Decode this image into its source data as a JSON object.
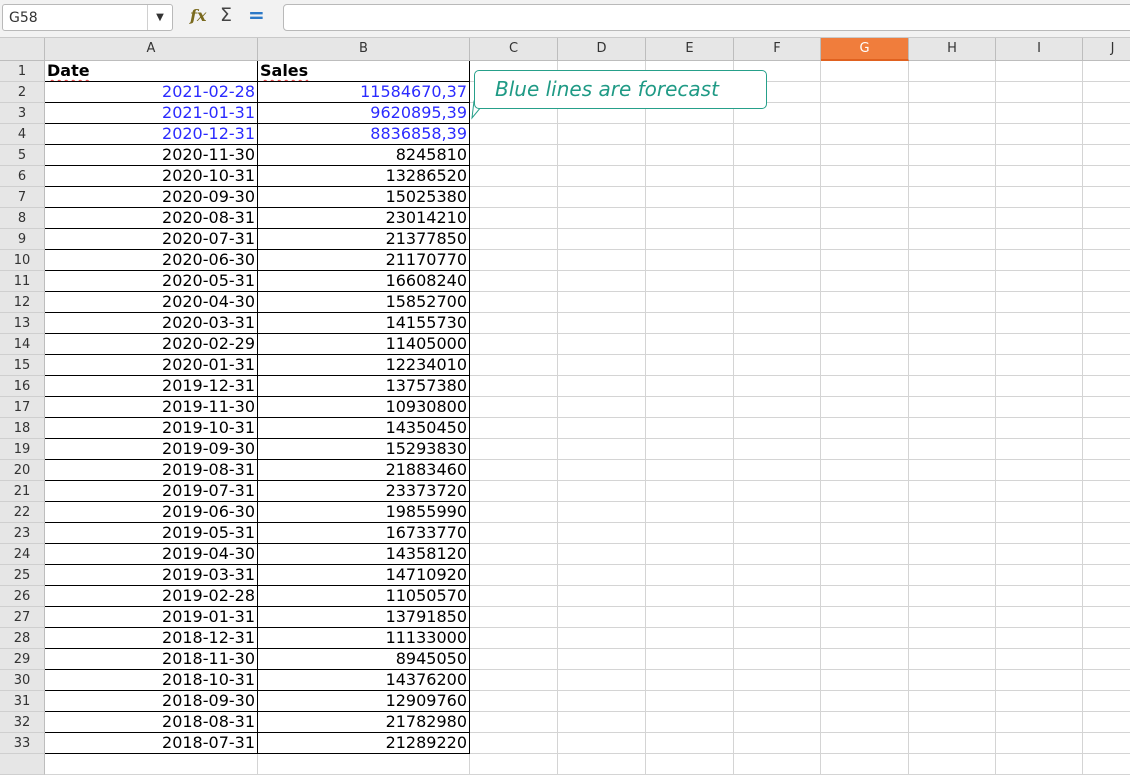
{
  "toolbar": {
    "name_box": "G58",
    "formula": ""
  },
  "columns": [
    "A",
    "B",
    "C",
    "D",
    "E",
    "F",
    "G",
    "H",
    "I",
    "J"
  ],
  "active_column": "G",
  "header_row": {
    "row": "1",
    "date": "Date",
    "sales": "Sales"
  },
  "rows": [
    {
      "row": "2",
      "date": "2021-02-28",
      "sales": "11584670,37",
      "forecast": true
    },
    {
      "row": "3",
      "date": "2021-01-31",
      "sales": "9620895,39",
      "forecast": true
    },
    {
      "row": "4",
      "date": "2020-12-31",
      "sales": "8836858,39",
      "forecast": true
    },
    {
      "row": "5",
      "date": "2020-11-30",
      "sales": "8245810",
      "forecast": false
    },
    {
      "row": "6",
      "date": "2020-10-31",
      "sales": "13286520",
      "forecast": false
    },
    {
      "row": "7",
      "date": "2020-09-30",
      "sales": "15025380",
      "forecast": false
    },
    {
      "row": "8",
      "date": "2020-08-31",
      "sales": "23014210",
      "forecast": false
    },
    {
      "row": "9",
      "date": "2020-07-31",
      "sales": "21377850",
      "forecast": false
    },
    {
      "row": "10",
      "date": "2020-06-30",
      "sales": "21170770",
      "forecast": false
    },
    {
      "row": "11",
      "date": "2020-05-31",
      "sales": "16608240",
      "forecast": false
    },
    {
      "row": "12",
      "date": "2020-04-30",
      "sales": "15852700",
      "forecast": false
    },
    {
      "row": "13",
      "date": "2020-03-31",
      "sales": "14155730",
      "forecast": false
    },
    {
      "row": "14",
      "date": "2020-02-29",
      "sales": "11405000",
      "forecast": false
    },
    {
      "row": "15",
      "date": "2020-01-31",
      "sales": "12234010",
      "forecast": false
    },
    {
      "row": "16",
      "date": "2019-12-31",
      "sales": "13757380",
      "forecast": false
    },
    {
      "row": "17",
      "date": "2019-11-30",
      "sales": "10930800",
      "forecast": false
    },
    {
      "row": "18",
      "date": "2019-10-31",
      "sales": "14350450",
      "forecast": false
    },
    {
      "row": "19",
      "date": "2019-09-30",
      "sales": "15293830",
      "forecast": false
    },
    {
      "row": "20",
      "date": "2019-08-31",
      "sales": "21883460",
      "forecast": false
    },
    {
      "row": "21",
      "date": "2019-07-31",
      "sales": "23373720",
      "forecast": false
    },
    {
      "row": "22",
      "date": "2019-06-30",
      "sales": "19855990",
      "forecast": false
    },
    {
      "row": "23",
      "date": "2019-05-31",
      "sales": "16733770",
      "forecast": false
    },
    {
      "row": "24",
      "date": "2019-04-30",
      "sales": "14358120",
      "forecast": false
    },
    {
      "row": "25",
      "date": "2019-03-31",
      "sales": "14710920",
      "forecast": false
    },
    {
      "row": "26",
      "date": "2019-02-28",
      "sales": "11050570",
      "forecast": false
    },
    {
      "row": "27",
      "date": "2019-01-31",
      "sales": "13791850",
      "forecast": false
    },
    {
      "row": "28",
      "date": "2018-12-31",
      "sales": "11133000",
      "forecast": false
    },
    {
      "row": "29",
      "date": "2018-11-30",
      "sales": "8945050",
      "forecast": false
    },
    {
      "row": "30",
      "date": "2018-10-31",
      "sales": "14376200",
      "forecast": false
    },
    {
      "row": "31",
      "date": "2018-09-30",
      "sales": "12909760",
      "forecast": false
    },
    {
      "row": "32",
      "date": "2018-08-31",
      "sales": "21782980",
      "forecast": false
    },
    {
      "row": "33",
      "date": "2018-07-31",
      "sales": "21289220",
      "forecast": false
    }
  ],
  "comment": {
    "text": "Blue lines are forecast"
  },
  "colors": {
    "forecast_text": "#2b2bff",
    "active_header": "#f07d3c",
    "comment": "#26a08a"
  },
  "icons": {
    "dropdown": "chevron-down-icon",
    "function_wizard": "function-wizard-icon",
    "sum": "sigma-icon",
    "formula": "equals-icon"
  }
}
